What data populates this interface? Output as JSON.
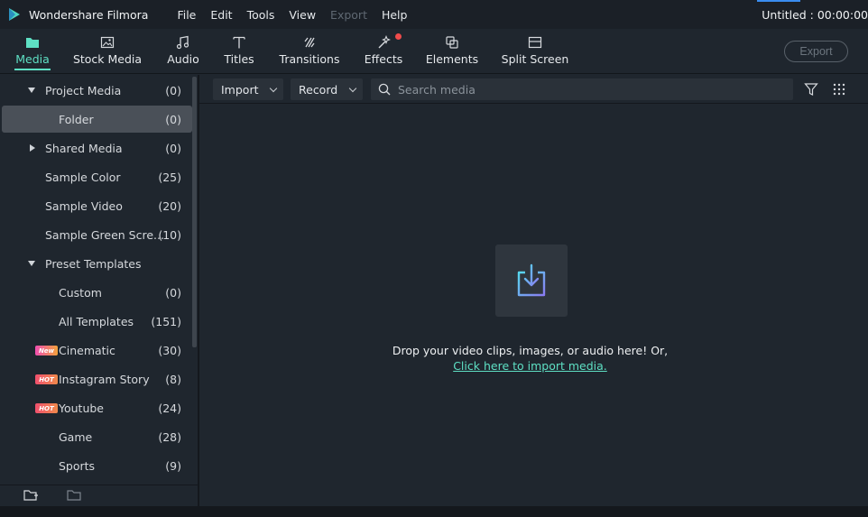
{
  "app": {
    "name": "Wondershare Filmora",
    "status": "Untitled : 00:00:00"
  },
  "menu": [
    {
      "label": "File",
      "enabled": true
    },
    {
      "label": "Edit",
      "enabled": true
    },
    {
      "label": "Tools",
      "enabled": true
    },
    {
      "label": "View",
      "enabled": true
    },
    {
      "label": "Export",
      "enabled": false
    },
    {
      "label": "Help",
      "enabled": true
    }
  ],
  "tabs": [
    {
      "label": "Media",
      "icon": "folder-icon",
      "active": true
    },
    {
      "label": "Stock Media",
      "icon": "image-icon",
      "active": false
    },
    {
      "label": "Audio",
      "icon": "music-note-icon",
      "active": false
    },
    {
      "label": "Titles",
      "icon": "text-t-icon",
      "active": false
    },
    {
      "label": "Transitions",
      "icon": "transition-icon",
      "active": false
    },
    {
      "label": "Effects",
      "icon": "magic-wand-icon",
      "active": false,
      "has_notification": true
    },
    {
      "label": "Elements",
      "icon": "layers-icon",
      "active": false
    },
    {
      "label": "Split Screen",
      "icon": "split-screen-icon",
      "active": false
    }
  ],
  "export_button": "Export",
  "sidebar": {
    "items": [
      {
        "label": "Project Media",
        "count": "(0)",
        "expanded": true,
        "level": 0,
        "caret": "down"
      },
      {
        "label": "Folder",
        "count": "(0)",
        "level": 1,
        "selected": true
      },
      {
        "label": "Shared Media",
        "count": "(0)",
        "level": 0,
        "caret": "right"
      },
      {
        "label": "Sample Color",
        "count": "(25)",
        "level": 0
      },
      {
        "label": "Sample Video",
        "count": "(20)",
        "level": 0
      },
      {
        "label": "Sample Green Scre...",
        "count": "(10)",
        "level": 0
      },
      {
        "label": "Preset Templates",
        "count": "",
        "level": 0,
        "caret": "down"
      },
      {
        "label": "Custom",
        "count": "(0)",
        "level": 1
      },
      {
        "label": "All Templates",
        "count": "(151)",
        "level": 1
      },
      {
        "label": "Cinematic",
        "count": "(30)",
        "level": 1,
        "badge": "New"
      },
      {
        "label": "Instagram Story",
        "count": "(8)",
        "level": 1,
        "badge": "HOT"
      },
      {
        "label": "Youtube",
        "count": "(24)",
        "level": 1,
        "badge": "HOT"
      },
      {
        "label": "Game",
        "count": "(28)",
        "level": 1
      },
      {
        "label": "Sports",
        "count": "(9)",
        "level": 1
      }
    ]
  },
  "media_toolbar": {
    "import_label": "Import",
    "record_label": "Record",
    "search_placeholder": "Search media"
  },
  "drop_zone": {
    "text": "Drop your video clips, images, or audio here! Or,",
    "link": "Click here to import media."
  },
  "colors": {
    "accent": "#5ee0c4",
    "background": "#1f262e",
    "notification": "#f04b4b"
  }
}
